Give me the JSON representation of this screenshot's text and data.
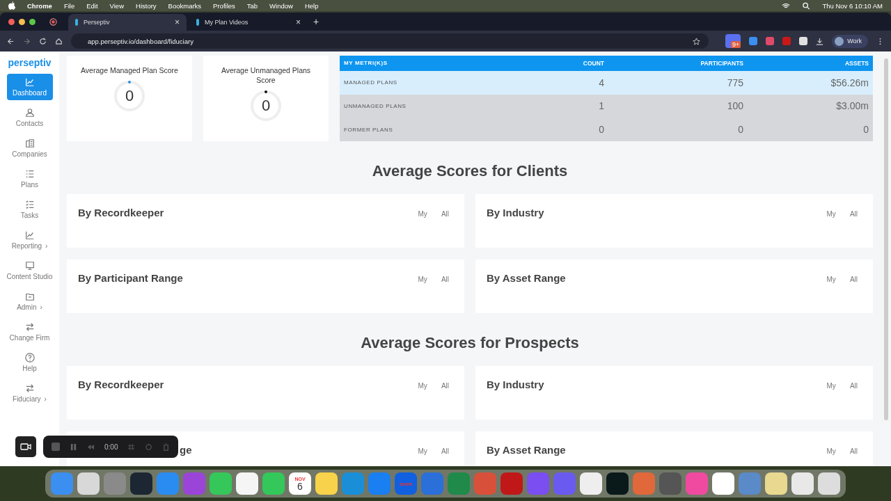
{
  "menubar": {
    "app": "Chrome",
    "items": [
      "File",
      "Edit",
      "View",
      "History",
      "Bookmarks",
      "Profiles",
      "Tab",
      "Window",
      "Help"
    ],
    "clock": "Thu Nov 6  10:10 AM"
  },
  "browser": {
    "tabs": [
      {
        "title": "Perseptiv",
        "selected": true,
        "close": "×"
      },
      {
        "title": "My Plan Videos",
        "selected": false,
        "close": "×"
      }
    ],
    "new_tab": "+",
    "url": "app.perseptiv.io/dashboard/fiduciary",
    "profile": "Work",
    "badge": "9+"
  },
  "sidebar": {
    "logo": "perseptiv",
    "items": [
      {
        "label": "Dashboard",
        "selected": true
      },
      {
        "label": "Contacts",
        "selected": false
      },
      {
        "label": "Companies",
        "selected": false
      },
      {
        "label": "Plans",
        "selected": false
      },
      {
        "label": "Tasks",
        "selected": false
      },
      {
        "label": "Reporting",
        "selected": false,
        "chevron": "›"
      },
      {
        "label": "Content Studio",
        "selected": false
      },
      {
        "label": "Admin",
        "selected": false,
        "chevron": "›"
      },
      {
        "label": "Change Firm",
        "selected": false
      },
      {
        "label": "Help",
        "selected": false
      },
      {
        "label": "Fiduciary",
        "selected": false,
        "chevron": "›"
      }
    ]
  },
  "score_cards": [
    {
      "title": "Average Managed Plan Score",
      "value": "0",
      "color": "#2f8fe0"
    },
    {
      "title": "Average Unmanaged Plans Score",
      "value": "0",
      "color": "#111111"
    }
  ],
  "metrics": {
    "columns": [
      "MY METRI(K)S",
      "COUNT",
      "PARTICIPANTS",
      "ASSETS"
    ],
    "rows": [
      {
        "cells": [
          "MANAGED PLANS",
          "4",
          "775",
          "$56.26m"
        ],
        "selected": true
      },
      {
        "cells": [
          "UNMANAGED PLANS",
          "1",
          "100",
          "$3.00m"
        ],
        "selected": false
      },
      {
        "cells": [
          "FORMER PLANS",
          "0",
          "0",
          "0"
        ],
        "selected": false
      }
    ]
  },
  "sections": [
    {
      "heading": "Average Scores for Clients",
      "cards": [
        {
          "title": "By Recordkeeper",
          "filters": [
            "My",
            "All"
          ]
        },
        {
          "title": "By Industry",
          "filters": [
            "My",
            "All"
          ]
        },
        {
          "title": "By Participant Range",
          "filters": [
            "My",
            "All"
          ]
        },
        {
          "title": "By Asset Range",
          "filters": [
            "My",
            "All"
          ]
        }
      ]
    },
    {
      "heading": "Average Scores for Prospects",
      "cards": [
        {
          "title": "By Recordkeeper",
          "filters": [
            "My",
            "All"
          ]
        },
        {
          "title": "By Industry",
          "filters": [
            "My",
            "All"
          ]
        },
        {
          "title": "ge",
          "covered": true,
          "filters": [
            "My",
            "All"
          ]
        },
        {
          "title": "By Asset Range",
          "filters": [
            "My",
            "All"
          ]
        }
      ]
    }
  ],
  "recorder": {
    "time": "0:00"
  },
  "dock": [
    {
      "color": "#3a8ff0"
    },
    {
      "color": "#d8d8d8"
    },
    {
      "color": "#8a8a8a"
    },
    {
      "color": "#1c2733"
    },
    {
      "color": "#2a8cf0"
    },
    {
      "color": "#9a45d8"
    },
    {
      "color": "#35c759"
    },
    {
      "color": "#f5f5f5"
    },
    {
      "color": "#34c759"
    },
    {
      "color": "#ffffff",
      "label": "NOV",
      "sub": "6"
    },
    {
      "color": "#f7d24a"
    },
    {
      "color": "#1a8fd8"
    },
    {
      "color": "#1a7ff0"
    },
    {
      "color": "#1060e0",
      "label": "zoom"
    },
    {
      "color": "#2b6fd8"
    },
    {
      "color": "#1f8a4a"
    },
    {
      "color": "#d9503a"
    },
    {
      "color": "#c01818"
    },
    {
      "color": "#7a4ef0"
    },
    {
      "color": "#6a5af0"
    },
    {
      "color": "#eeeeee"
    },
    {
      "color": "#0a1a1a"
    },
    {
      "color": "#e0683a"
    },
    {
      "color": "#555555"
    },
    {
      "color": "#f04aa0"
    },
    {
      "color": "#ffffff"
    },
    {
      "color": "#5a8ac8"
    },
    {
      "color": "#e8d890"
    },
    {
      "color": "#e8e8e8"
    },
    {
      "color": "#dddddd"
    }
  ]
}
